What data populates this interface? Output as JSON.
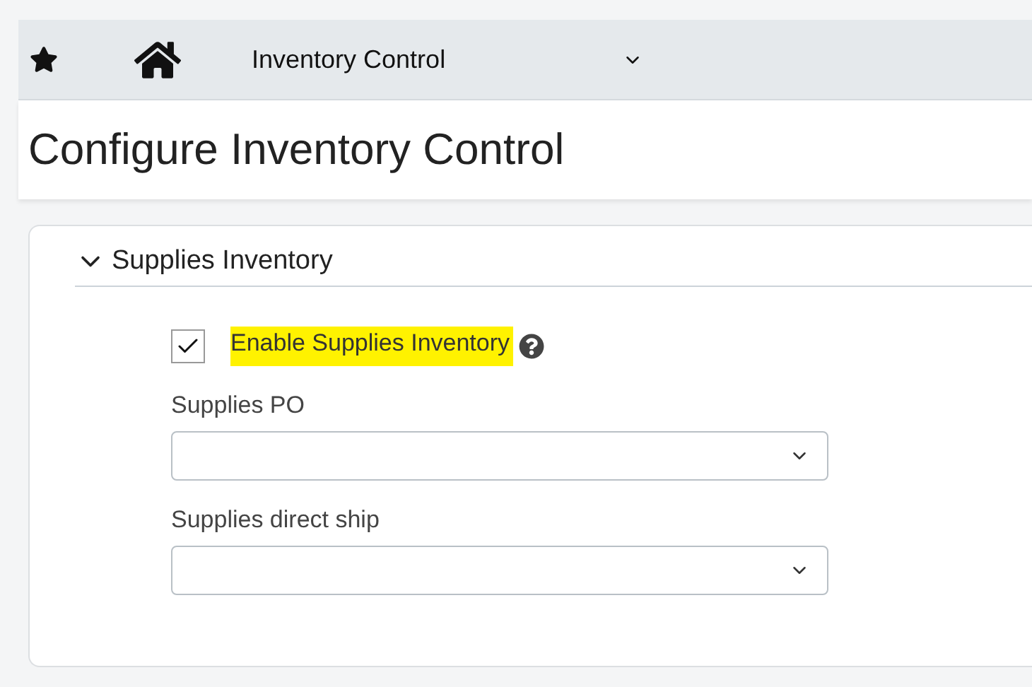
{
  "toolbar": {
    "module": "Inventory Control"
  },
  "page_title": "Configure Inventory Control",
  "section": {
    "title": "Supplies Inventory",
    "expanded": true,
    "checkbox": {
      "label": "Enable Supplies Inventory",
      "checked": true,
      "highlighted": true
    },
    "fields": [
      {
        "label": "Supplies PO"
      },
      {
        "label": "Supplies direct ship"
      }
    ]
  }
}
